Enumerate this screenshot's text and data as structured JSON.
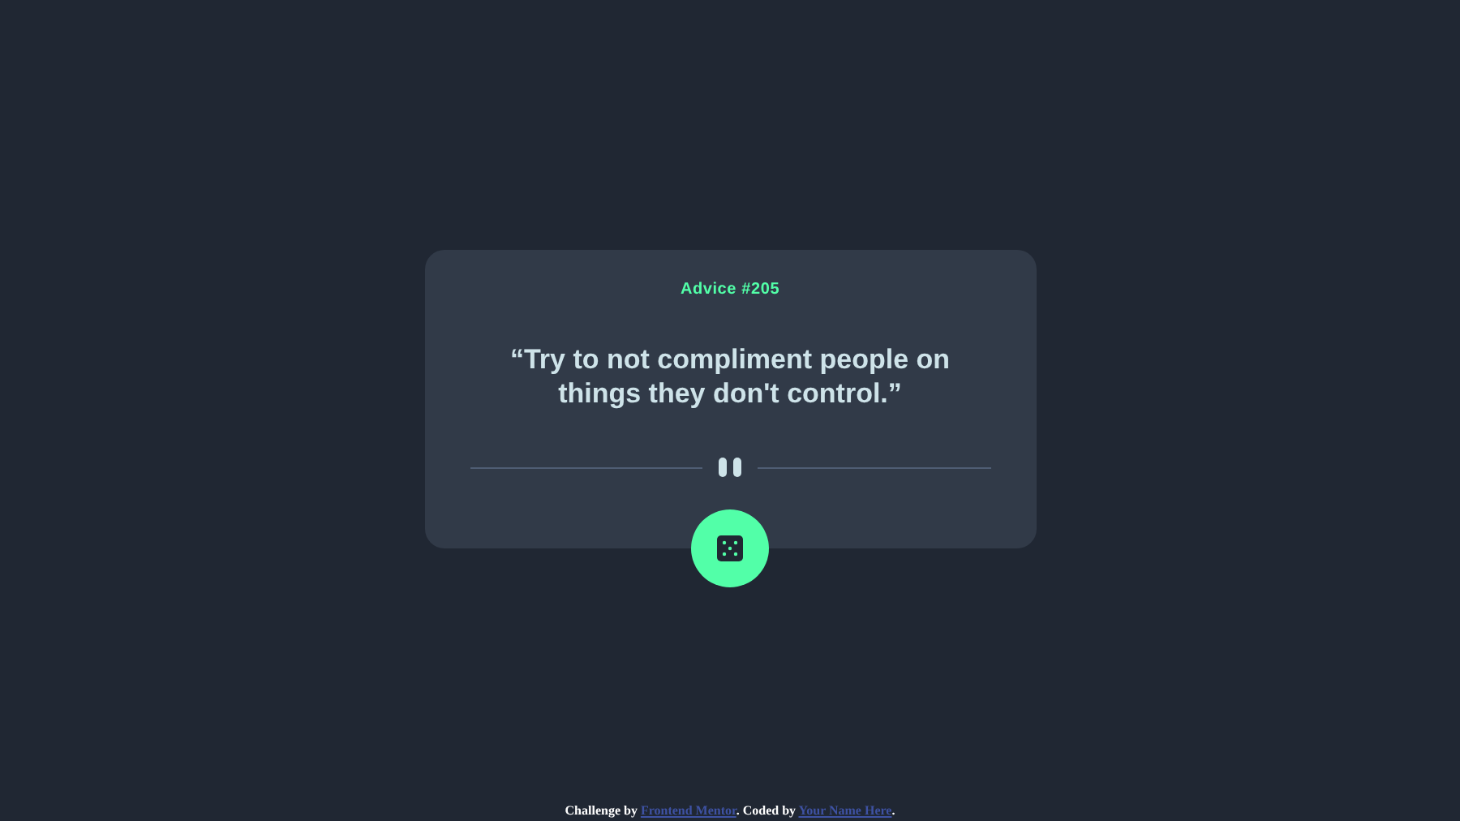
{
  "card": {
    "title": "Advice #205",
    "quote": "“Try to not compliment people on things they don't control.”"
  },
  "footer": {
    "segments": [
      {
        "kind": "text",
        "text": "Challenge by "
      },
      {
        "kind": "link",
        "text": "Frontend Mentor"
      },
      {
        "kind": "text",
        "text": ". Coded by "
      },
      {
        "kind": "link",
        "text": "Your Name Here"
      },
      {
        "kind": "text",
        "text": "."
      }
    ]
  }
}
